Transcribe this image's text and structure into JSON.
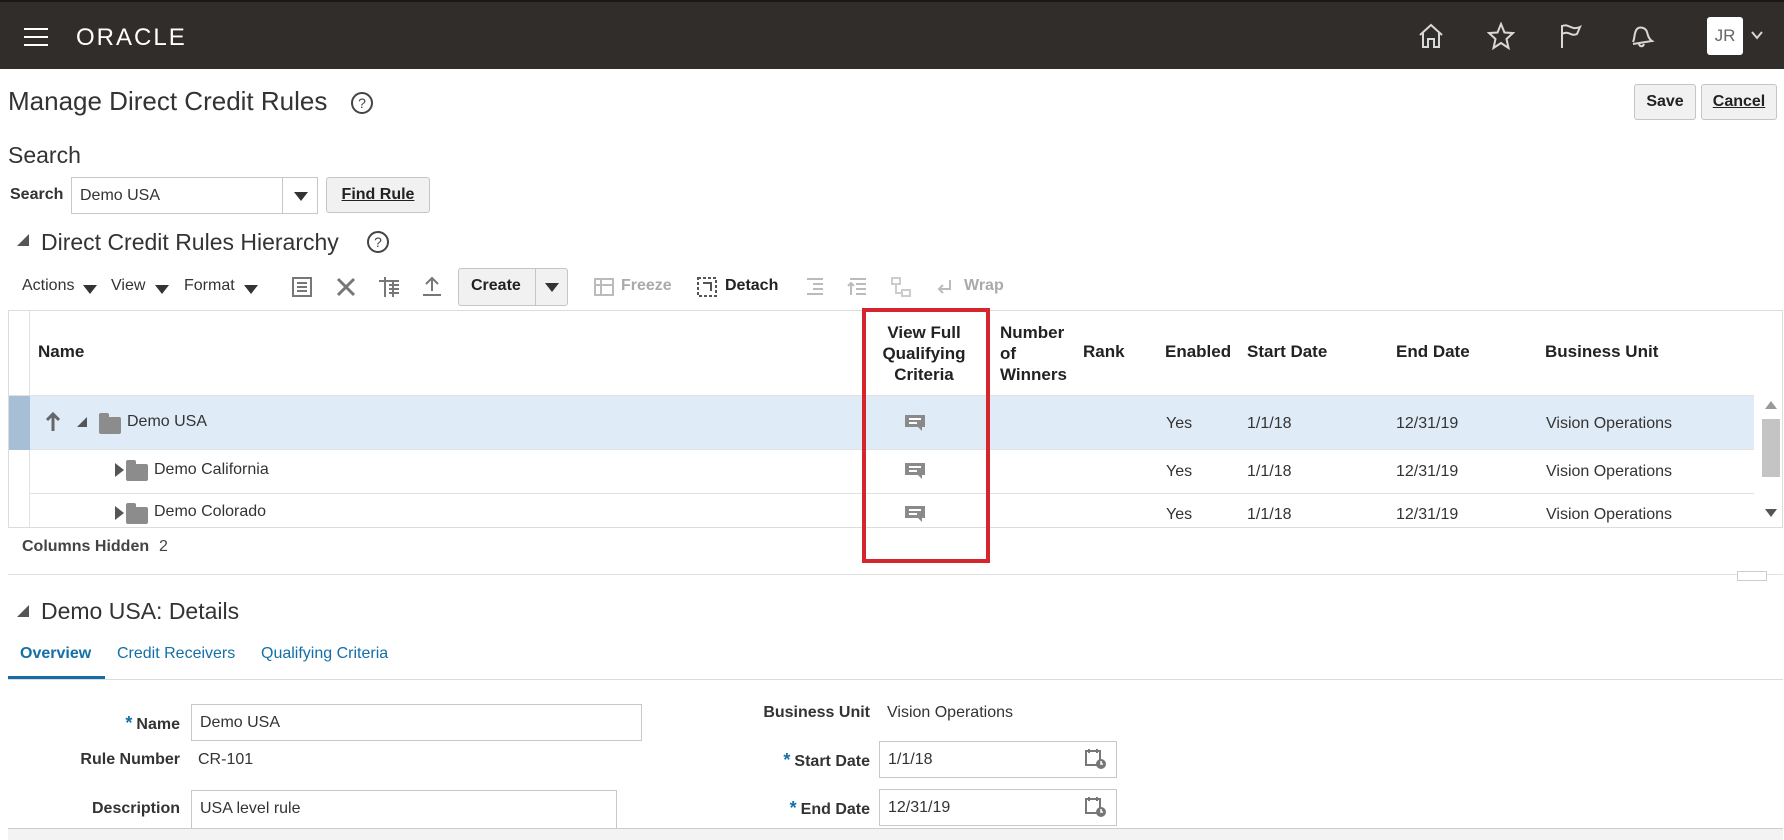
{
  "header": {
    "logo": "ORACLE",
    "avatar_initials": "JR"
  },
  "page": {
    "title": "Manage Direct Credit Rules",
    "save_label": "Save",
    "cancel_label": "Cancel"
  },
  "search": {
    "heading": "Search",
    "label": "Search",
    "value": "Demo USA",
    "find_label": "Find Rule"
  },
  "hierarchy": {
    "heading": "Direct Credit Rules Hierarchy",
    "toolbar": {
      "actions": "Actions",
      "view": "View",
      "format": "Format",
      "create": "Create",
      "freeze": "Freeze",
      "detach": "Detach",
      "wrap": "Wrap"
    },
    "columns": {
      "name": "Name",
      "view_full": [
        "View Full",
        "Qualifying",
        "Criteria"
      ],
      "winners": [
        "Number",
        "of",
        "Winners"
      ],
      "rank": "Rank",
      "enabled": "Enabled",
      "start_date": "Start Date",
      "end_date": "End Date",
      "business_unit": "Business Unit"
    },
    "rows": [
      {
        "name": "Demo USA",
        "enabled": "Yes",
        "start": "1/1/18",
        "end": "12/31/19",
        "bu": "Vision Operations"
      },
      {
        "name": "Demo California",
        "enabled": "Yes",
        "start": "1/1/18",
        "end": "12/31/19",
        "bu": "Vision Operations"
      },
      {
        "name": "Demo Colorado",
        "enabled": "Yes",
        "start": "1/1/18",
        "end": "12/31/19",
        "bu": "Vision Operations"
      }
    ],
    "columns_hidden_label": "Columns Hidden",
    "columns_hidden_count": "2"
  },
  "details": {
    "heading": "Demo USA: Details",
    "tabs": [
      "Overview",
      "Credit Receivers",
      "Qualifying Criteria"
    ],
    "name_label": "Name",
    "name_value": "Demo USA",
    "rule_number_label": "Rule Number",
    "rule_number_value": "CR-101",
    "description_label": "Description",
    "description_value": "USA level rule",
    "bu_label": "Business Unit",
    "bu_value": "Vision Operations",
    "start_label": "Start Date",
    "start_value": "1/1/18",
    "end_label": "End Date",
    "end_value": "12/31/19"
  },
  "colors": {
    "header_bg": "#312d2a",
    "link": "#146fa8",
    "highlight_box": "#d6262d",
    "selected_row": "#dfecf8"
  }
}
